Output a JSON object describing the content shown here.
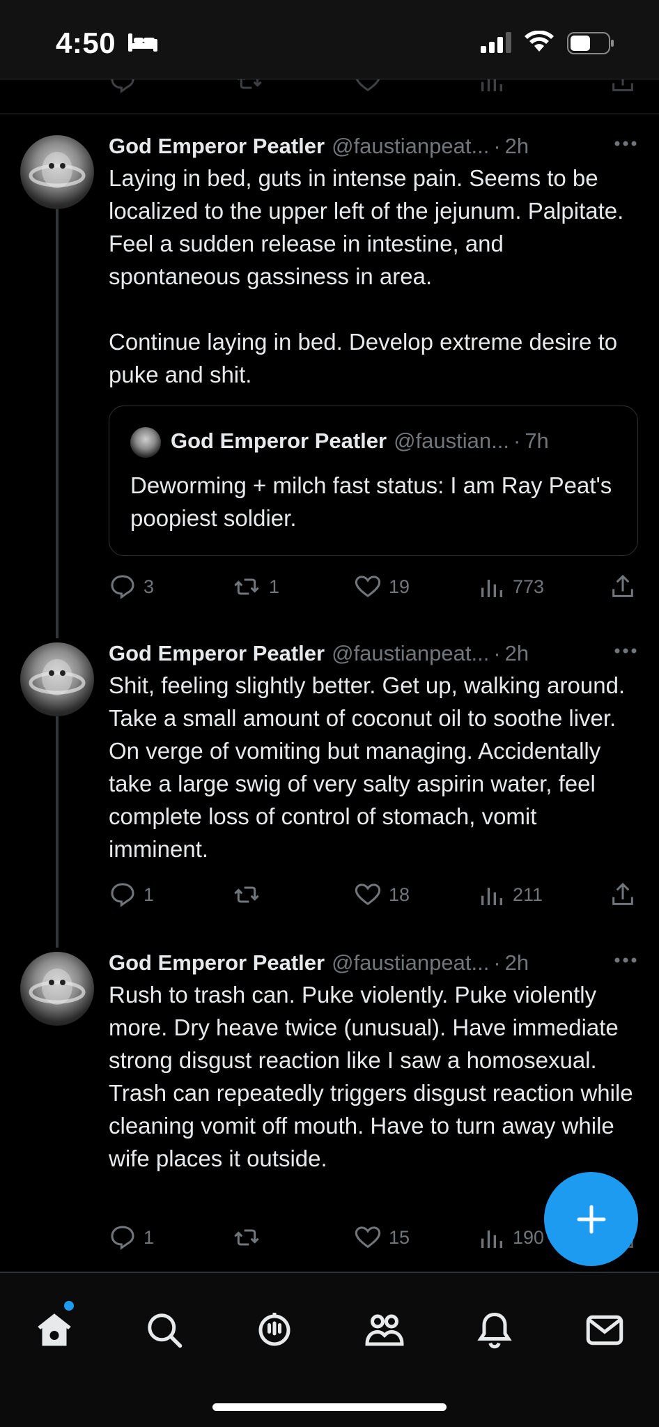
{
  "status_bar": {
    "time": "4:50"
  },
  "tweets": [
    {
      "name": "God Emperor Peatler",
      "handle": "@faustianpeat...",
      "dot": "·",
      "time": "2h",
      "text": "Laying in bed, guts in intense pain. Seems to be localized to the upper left of the jejunum. Palpitate. Feel a sudden release in intestine, and spontaneous gassiness in area.\n\nContinue laying in bed. Develop extreme desire to puke and shit.",
      "quote": {
        "name": "God Emperor Peatler",
        "handle": "@faustian...",
        "dot": "·",
        "time": "7h",
        "text": "Deworming + milch fast status: I am Ray Peat's poopiest soldier."
      },
      "replies": "3",
      "retweets": "1",
      "likes": "19",
      "views": "773"
    },
    {
      "name": "God Emperor Peatler",
      "handle": "@faustianpeat...",
      "dot": "·",
      "time": "2h",
      "text": "Shit, feeling slightly better. Get up, walking around. Take a small amount of coconut oil to soothe liver. On verge of vomiting but managing. Accidentally take a large swig of very salty aspirin water, feel complete loss of control of stomach, vomit imminent.",
      "replies": "1",
      "retweets": "",
      "likes": "18",
      "views": "211"
    },
    {
      "name": "God Emperor Peatler",
      "handle": "@faustianpeat...",
      "dot": "·",
      "time": "2h",
      "text": "Rush to trash can. Puke violently. Puke violently more. Dry heave twice (unusual). Have immediate strong disgust reaction like I saw a homosexual. Trash can repeatedly triggers disgust reaction while cleaning vomit off mouth. Have to turn away while wife places it outside.",
      "replies": "1",
      "retweets": "",
      "likes": "15",
      "views": "190"
    }
  ],
  "icons": {
    "reply": "speech-bubble-icon",
    "retweet": "retweet-arrows-icon",
    "like": "heart-icon",
    "views": "bar-chart-icon",
    "share": "share-upload-icon",
    "compose": "plus-icon"
  },
  "nav": [
    "home-icon",
    "search-icon",
    "spaces-icon",
    "communities-icon",
    "notifications-icon",
    "messages-icon"
  ],
  "colors": {
    "accent": "#1d9bf0",
    "background": "#000000",
    "muted": "#71767b",
    "text": "#e7e9ea"
  }
}
